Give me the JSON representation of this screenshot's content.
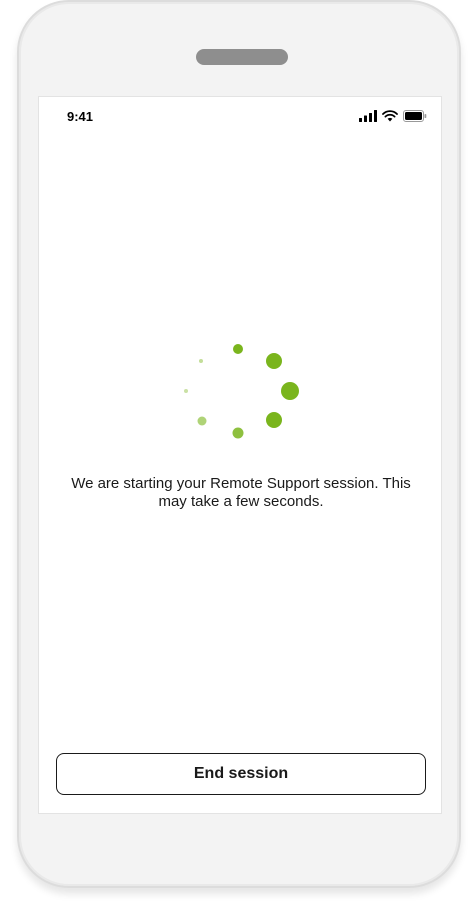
{
  "status_bar": {
    "time": "9:41",
    "icons": [
      "cellular-signal-icon",
      "wifi-icon",
      "battery-icon"
    ]
  },
  "loading": {
    "message": "We are starting your Remote Support session. This may take a few seconds.",
    "spinner_color": "#7ab51d"
  },
  "actions": {
    "end_session_label": "End session"
  }
}
